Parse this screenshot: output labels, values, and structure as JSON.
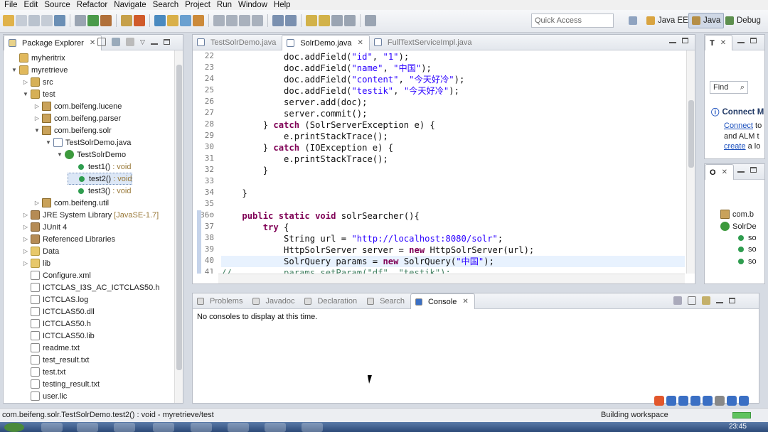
{
  "menu": [
    "File",
    "Edit",
    "Source",
    "Refactor",
    "Navigate",
    "Search",
    "Project",
    "Run",
    "Window",
    "Help"
  ],
  "toolbar": {
    "quick_access_placeholder": "Quick Access",
    "perspectives": [
      "Java EE",
      "Java",
      "Debug"
    ]
  },
  "package_explorer": {
    "title": "Package Explorer",
    "items": [
      {
        "label": "myheritrix",
        "icon": "project-icon",
        "depth": 0,
        "twisty": ""
      },
      {
        "label": "myretrieve",
        "icon": "project-icon",
        "depth": 0,
        "twisty": "▼"
      },
      {
        "label": "src",
        "icon": "source-folder-icon",
        "depth": 1,
        "twisty": "▷"
      },
      {
        "label": "test",
        "icon": "source-folder-icon",
        "depth": 1,
        "twisty": "▼"
      },
      {
        "label": "com.beifeng.lucene",
        "icon": "package-icon",
        "depth": 2,
        "twisty": "▷"
      },
      {
        "label": "com.beifeng.parser",
        "icon": "package-icon",
        "depth": 2,
        "twisty": "▷"
      },
      {
        "label": "com.beifeng.solr",
        "icon": "package-icon",
        "depth": 2,
        "twisty": "▼"
      },
      {
        "label": "TestSolrDemo.java",
        "icon": "java-file-icon",
        "depth": 3,
        "twisty": "▼"
      },
      {
        "label": "TestSolrDemo",
        "icon": "class-icon",
        "depth": 4,
        "twisty": "▼"
      },
      {
        "label": "test1()",
        "suffix": ": void",
        "icon": "method-icon",
        "depth": 5,
        "twisty": ""
      },
      {
        "label": "test2()",
        "suffix": ": void",
        "icon": "method-icon",
        "depth": 5,
        "twisty": "",
        "selected": true
      },
      {
        "label": "test3()",
        "suffix": ": void",
        "icon": "method-icon",
        "depth": 5,
        "twisty": ""
      },
      {
        "label": "com.beifeng.util",
        "icon": "package-icon",
        "depth": 2,
        "twisty": "▷"
      },
      {
        "label": "JRE System Library",
        "suffix": "[JavaSE-1.7]",
        "icon": "library-icon",
        "depth": 1,
        "twisty": "▷"
      },
      {
        "label": "JUnit 4",
        "icon": "library-icon",
        "depth": 1,
        "twisty": "▷"
      },
      {
        "label": "Referenced Libraries",
        "icon": "library-icon",
        "depth": 1,
        "twisty": "▷"
      },
      {
        "label": "Data",
        "icon": "folder-icon",
        "depth": 1,
        "twisty": "▷"
      },
      {
        "label": "lib",
        "icon": "folder-icon",
        "depth": 1,
        "twisty": "▷"
      },
      {
        "label": "Configure.xml",
        "icon": "xml-file-icon",
        "depth": 1,
        "twisty": ""
      },
      {
        "label": "ICTCLAS_I3S_AC_ICTCLAS50.h",
        "icon": "file-icon",
        "depth": 1,
        "twisty": ""
      },
      {
        "label": "ICTCLAS.log",
        "icon": "file-icon",
        "depth": 1,
        "twisty": ""
      },
      {
        "label": "ICTCLAS50.dll",
        "icon": "file-icon",
        "depth": 1,
        "twisty": ""
      },
      {
        "label": "ICTCLAS50.h",
        "icon": "file-icon",
        "depth": 1,
        "twisty": ""
      },
      {
        "label": "ICTCLAS50.lib",
        "icon": "file-icon",
        "depth": 1,
        "twisty": ""
      },
      {
        "label": "readme.txt",
        "icon": "file-icon",
        "depth": 1,
        "twisty": ""
      },
      {
        "label": "test_result.txt",
        "icon": "file-icon",
        "depth": 1,
        "twisty": ""
      },
      {
        "label": "test.txt",
        "icon": "file-icon",
        "depth": 1,
        "twisty": ""
      },
      {
        "label": "testing_result.txt",
        "icon": "file-icon",
        "depth": 1,
        "twisty": ""
      },
      {
        "label": "user.lic",
        "icon": "file-icon",
        "depth": 1,
        "twisty": ""
      }
    ]
  },
  "editor": {
    "tabs": [
      {
        "label": "TestSolrDemo.java",
        "active": false
      },
      {
        "label": "SolrDemo.java",
        "active": true
      },
      {
        "label": "FullTextServiceImpl.java",
        "active": false
      }
    ],
    "lines": [
      {
        "n": "22",
        "html": "            doc.addField(<span class=\"str\">\"id\"</span>, <span class=\"str\">\"1\"</span>);"
      },
      {
        "n": "23",
        "html": "            doc.addField(<span class=\"str\">\"name\"</span>, <span class=\"str\">\"中国\"</span>);"
      },
      {
        "n": "24",
        "html": "            doc.addField(<span class=\"str\">\"content\"</span>, <span class=\"str\">\"今天好冷\"</span>);"
      },
      {
        "n": "25",
        "html": "            doc.addField(<span class=\"str\">\"testik\"</span>, <span class=\"str\">\"今天好冷\"</span>);"
      },
      {
        "n": "26",
        "html": "            server.add(doc);"
      },
      {
        "n": "27",
        "html": "            server.commit();"
      },
      {
        "n": "28",
        "html": "        } <span class=\"kw\">catch</span> (SolrServerException e) {"
      },
      {
        "n": "29",
        "html": "            e.printStackTrace();"
      },
      {
        "n": "30",
        "html": "        } <span class=\"kw\">catch</span> (IOException e) {"
      },
      {
        "n": "31",
        "html": "            e.printStackTrace();"
      },
      {
        "n": "32",
        "html": "        }"
      },
      {
        "n": "33",
        "html": ""
      },
      {
        "n": "34",
        "html": "    }"
      },
      {
        "n": "35",
        "html": ""
      },
      {
        "n": "36⊖",
        "html": "    <span class=\"kw\">public static void</span> solrSearcher(){"
      },
      {
        "n": "37",
        "html": "        <span class=\"kw\">try</span> {"
      },
      {
        "n": "38",
        "html": "            String url = <span class=\"str\">\"http://localhost:8080/solr\"</span>;"
      },
      {
        "n": "39",
        "html": "            HttpSolrServer server = <span class=\"kw\">new</span> HttpSolrServer(url);"
      },
      {
        "n": "40",
        "html": "            SolrQuery params = <span class=\"kw\">new</span> SolrQuery(<span class=\"str\">\"中国\"</span>);",
        "current": true
      },
      {
        "n": "41",
        "html": "<span class=\"cmt\">//          params.setParam(\"df\", \"testik\");</span>"
      }
    ]
  },
  "console": {
    "tabs": [
      "Problems",
      "Javadoc",
      "Declaration",
      "Search",
      "Console"
    ],
    "active_tab": "Console",
    "message": "No consoles to display at this time."
  },
  "task_list": {
    "find_placeholder": "Find",
    "connect_title": "Connect M",
    "connect_lines": [
      {
        "link": "Connect",
        "text": " to"
      },
      {
        "link": "",
        "text": "and ALM t"
      },
      {
        "link": "create",
        "text": " a lo"
      }
    ]
  },
  "outline": {
    "items": [
      {
        "label": "com.b",
        "icon": "package-icon"
      },
      {
        "label": "SolrDe",
        "icon": "class-icon"
      },
      {
        "label": "so",
        "icon": "method-icon"
      },
      {
        "label": "so",
        "icon": "method-icon"
      },
      {
        "label": "so",
        "icon": "method-icon"
      }
    ]
  },
  "status": {
    "selection": "com.beifeng.solr.TestSolrDemo.test2() : void - myretrieve/test",
    "building": "Building workspace"
  },
  "clock": "23:45"
}
